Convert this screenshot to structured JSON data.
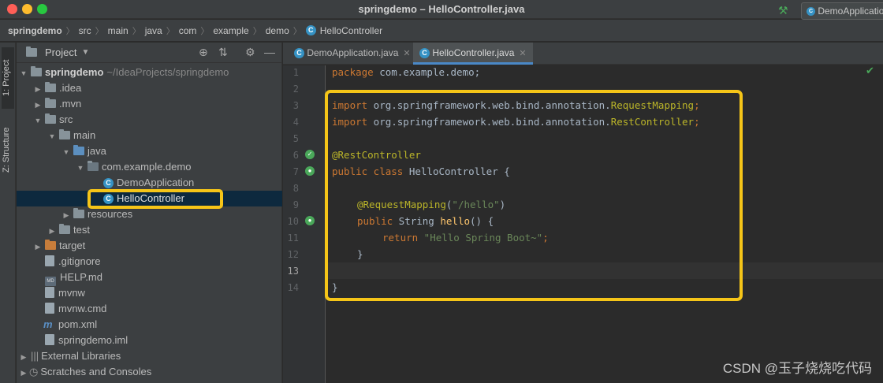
{
  "window": {
    "title": "springdemo – HelloController.java"
  },
  "breadcrumbs": [
    "springdemo",
    "src",
    "main",
    "java",
    "com",
    "example",
    "demo",
    "HelloController"
  ],
  "run_config": {
    "label": "DemoApplication"
  },
  "tool_stripe": {
    "project_tab": "1: Project",
    "structure_tab": "Z: Structure"
  },
  "project_panel": {
    "title": "Project",
    "tree": [
      {
        "label": "springdemo",
        "extra": "~/IdeaProjects/springdemo"
      },
      {
        "label": ".idea"
      },
      {
        "label": ".mvn"
      },
      {
        "label": "src"
      },
      {
        "label": "main"
      },
      {
        "label": "java"
      },
      {
        "label": "com.example.demo"
      },
      {
        "label": "DemoApplication"
      },
      {
        "label": "HelloController"
      },
      {
        "label": "resources"
      },
      {
        "label": "test"
      },
      {
        "label": "target"
      },
      {
        "label": ".gitignore"
      },
      {
        "label": "HELP.md"
      },
      {
        "label": "mvnw"
      },
      {
        "label": "mvnw.cmd"
      },
      {
        "label": "pom.xml"
      },
      {
        "label": "springdemo.iml"
      },
      {
        "label": "External Libraries"
      },
      {
        "label": "Scratches and Consoles"
      }
    ]
  },
  "editor": {
    "tabs": [
      {
        "label": "DemoApplication.java"
      },
      {
        "label": "HelloController.java"
      }
    ],
    "line_numbers": [
      "1",
      "2",
      "3",
      "4",
      "5",
      "6",
      "7",
      "8",
      "9",
      "10",
      "11",
      "12",
      "13",
      "14"
    ],
    "code": {
      "l1_kw": "package",
      "l1_rest": " com.example.demo;",
      "l3_kw": "import",
      "l3_pkg": " org.springframework.web.bind.annotation.",
      "l3_cls": "RequestMapping",
      "l3_end": ";",
      "l4_kw": "import",
      "l4_pkg": " org.springframework.web.bind.annotation.",
      "l4_cls": "RestController",
      "l4_end": ";",
      "l6": "@RestController",
      "l7_kw": "public class",
      "l7_rest": " HelloController {",
      "l9_ann": "@RequestMapping",
      "l9_open": "(",
      "l9_str": "\"/hello\"",
      "l9_close": ")",
      "l10_kw": "public",
      "l10_type": " String ",
      "l10_fn": "hello",
      "l10_rest": "() {",
      "l11_kw": "return",
      "l11_str": " \"Hello Spring Boot~\"",
      "l11_end": ";",
      "l12": "}",
      "l14": "}"
    }
  },
  "watermark": "CSDN @玉子烧烧吃代码",
  "colors": {
    "highlight": "#f5c518",
    "keyword": "#cc7832",
    "annotation": "#bbb529",
    "string": "#6a8759"
  }
}
